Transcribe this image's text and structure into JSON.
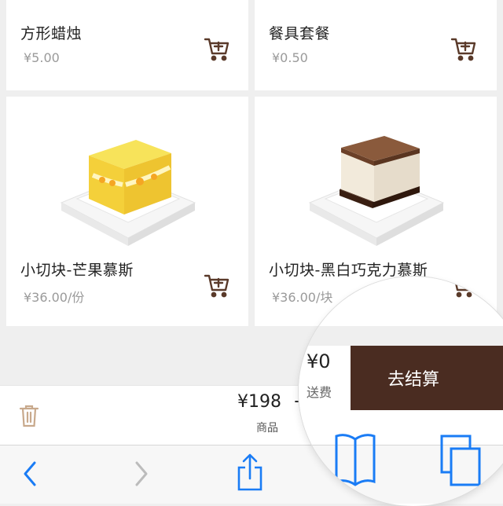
{
  "products": [
    {
      "name": "方形蜡烛",
      "price": "¥5.00"
    },
    {
      "name": "餐具套餐",
      "price": "¥0.50"
    },
    {
      "name": "小切块-芒果慕斯",
      "price": "¥36.00/份"
    },
    {
      "name": "小切块-黑白巧克力慕斯",
      "price": "¥36.00/块"
    }
  ],
  "cart": {
    "total": "¥198",
    "total_sep": "+",
    "total_label": "商品",
    "delivery_fee": "¥0",
    "delivery_label": "送费",
    "checkout_label": "去结算"
  },
  "icons": {
    "add_to_cart": "cart-plus-icon",
    "trash": "trash-icon",
    "back": "chevron-left-icon",
    "forward": "chevron-right-icon",
    "share": "share-icon",
    "bookmarks": "book-icon",
    "tabs": "tabs-icon"
  },
  "colors": {
    "accent": "#4a2c21",
    "cart_icon": "#5a3a2a",
    "browser_blue": "#1a7cf5"
  }
}
